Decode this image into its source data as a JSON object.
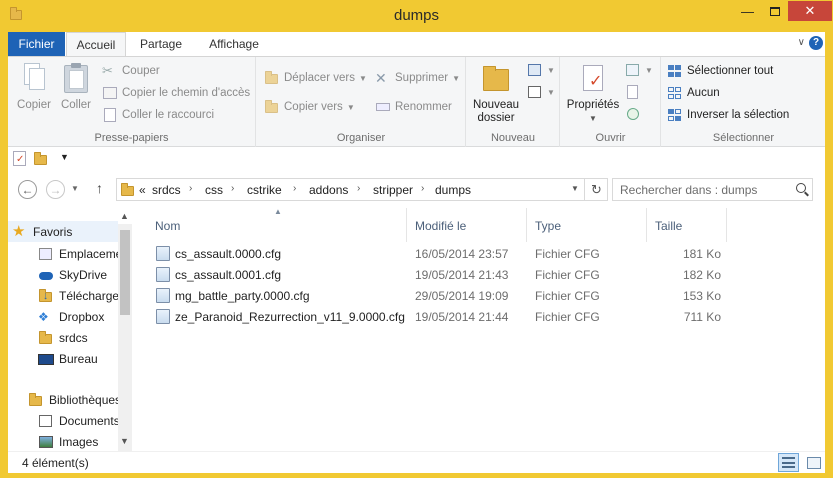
{
  "window": {
    "title": "dumps"
  },
  "tabs": {
    "file": "Fichier",
    "home": "Accueil",
    "share": "Partage",
    "view": "Affichage"
  },
  "ribbon": {
    "clipboard": {
      "label": "Presse-papiers",
      "copy": "Copier",
      "paste": "Coller",
      "cut": "Couper",
      "copy_path": "Copier le chemin d'accès",
      "paste_shortcut": "Coller le raccourci"
    },
    "organize": {
      "label": "Organiser",
      "move_to": "Déplacer vers",
      "copy_to": "Copier vers",
      "delete": "Supprimer",
      "rename": "Renommer"
    },
    "new": {
      "label": "Nouveau",
      "new_folder": "Nouveau\ndossier"
    },
    "open": {
      "label": "Ouvrir",
      "properties": "Propriétés"
    },
    "select": {
      "label": "Sélectionner",
      "select_all": "Sélectionner tout",
      "none": "Aucun",
      "invert": "Inverser la sélection"
    }
  },
  "address": {
    "prefix": "«",
    "crumbs": [
      "srdcs",
      "css",
      "cstrike",
      "addons",
      "stripper",
      "dumps"
    ],
    "search_placeholder": "Rechercher dans : dumps"
  },
  "navpane": {
    "favorites": "Favoris",
    "items": [
      "Emplacements récents",
      "SkyDrive",
      "Téléchargements",
      "Dropbox",
      "srdcs",
      "Bureau"
    ],
    "libraries": "Bibliothèques",
    "lib_items": [
      "Documents",
      "Images"
    ]
  },
  "columns": {
    "name": "Nom",
    "date": "Modifié le",
    "type": "Type",
    "size": "Taille"
  },
  "files": [
    {
      "name": "cs_assault.0000.cfg",
      "date": "16/05/2014 23:57",
      "type": "Fichier CFG",
      "size": "181 Ko"
    },
    {
      "name": "cs_assault.0001.cfg",
      "date": "19/05/2014 21:43",
      "type": "Fichier CFG",
      "size": "182 Ko"
    },
    {
      "name": "mg_battle_party.0000.cfg",
      "date": "29/05/2014 19:09",
      "type": "Fichier CFG",
      "size": "153 Ko"
    },
    {
      "name": "ze_Paranoid_Rezurrection_v11_9.0000.cfg",
      "date": "19/05/2014 21:44",
      "type": "Fichier CFG",
      "size": "711 Ko"
    }
  ],
  "status": {
    "count": "4 élément(s)"
  },
  "colors": {
    "frame": "#f1c932",
    "file_tab": "#1e63b6",
    "close": "#c7463a",
    "header_text": "#4c607a"
  }
}
